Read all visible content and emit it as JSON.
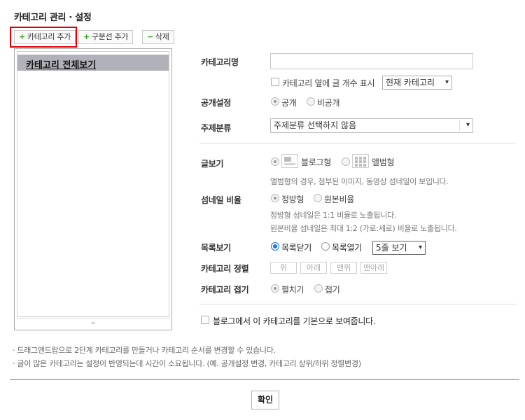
{
  "header": {
    "title": "카테고리 관리 · 설정"
  },
  "toolbar": {
    "add_category": "카테고리 추가",
    "add_divider": "구분선 추가",
    "delete": "삭제"
  },
  "category_list": {
    "items": [
      {
        "label": "카테고리 전체보기",
        "selected": true
      }
    ],
    "footer_handle": "⩧"
  },
  "form": {
    "category_name": {
      "label": "카테고리명",
      "value": "",
      "placeholder": ""
    },
    "show_post_count": {
      "label": "카테고리 옆에 글 개수 표시",
      "checked": false,
      "select_value": "현재 카테고리"
    },
    "visibility": {
      "label": "공개설정",
      "options": [
        "공개",
        "비공개"
      ],
      "selected": "공개"
    },
    "topic": {
      "label": "주제분류",
      "value": "주제분류 선택하지 않음"
    },
    "post_view": {
      "label": "글보기",
      "options": [
        "블로그형",
        "앨범형"
      ],
      "selected": "블로그형",
      "desc": "앨범형의 경우, 첨부된 이미지, 동영상 섬네일이 보입니다."
    },
    "thumbnail_ratio": {
      "label": "섬네일 비율",
      "options": [
        "정방형",
        "원본비율"
      ],
      "selected": "정방형",
      "desc1": "정방형 섬네일은 1:1 비율로 노출됩니다.",
      "desc2": "원본비율 섬네일은 최대 1:2 (가로:세로) 비율로 노출됩니다."
    },
    "list_view": {
      "label": "목록보기",
      "options": [
        "목록닫기",
        "목록열기"
      ],
      "selected": "목록닫기",
      "select_value": "5줄 보기"
    },
    "sort": {
      "label": "카테고리 정렬",
      "buttons": [
        "위",
        "아래",
        "맨위",
        "맨아래"
      ]
    },
    "fold": {
      "label": "카테고리 접기",
      "options": [
        "펼치기",
        "접기"
      ],
      "selected": "펼치기"
    },
    "default_view": {
      "label": "블로그에서 이 카테고리를 기본으로 보여줍니다.",
      "checked": false
    }
  },
  "notes": [
    "· 드래그앤드랍으로 2단계 카테고리를 만들거나 카테고리 순서를 변경할 수 있습니다.",
    "· 글이 많은 카테고리는 설정이 반영되는데 시간이 소요됩니다. (예. 공개설정 변경, 카테고리 상위/하위 정렬변경)"
  ],
  "confirm_label": "확인",
  "colors": {
    "highlight": "#e00000",
    "accent_green": "#2e9e1c",
    "radio_blue": "#1a73e8",
    "selected_row": "#b1b1b9"
  }
}
